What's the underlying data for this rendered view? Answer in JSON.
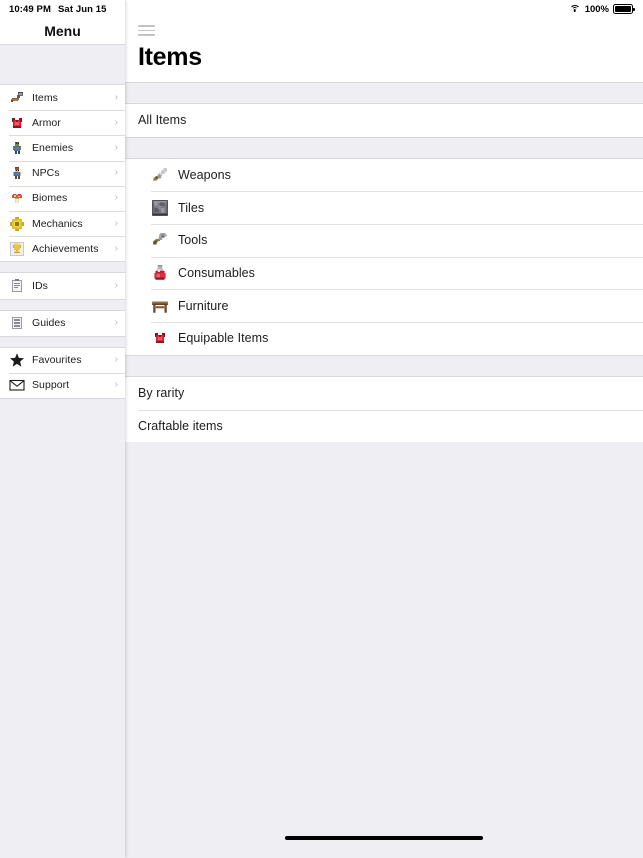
{
  "status_bar": {
    "time": "10:49 PM",
    "date": "Sat Jun 15",
    "battery_percent": "100%",
    "wifi_icon": "wifi-icon",
    "battery_icon": "battery-full-icon"
  },
  "sidebar": {
    "title": "Menu",
    "chevron": "›",
    "groups": [
      {
        "items": [
          {
            "label": "Items",
            "icon": "warhammer-icon"
          },
          {
            "label": "Armor",
            "icon": "breastplate-icon"
          },
          {
            "label": "Enemies",
            "icon": "zombie-icon"
          },
          {
            "label": "NPCs",
            "icon": "npc-guide-icon"
          },
          {
            "label": "Biomes",
            "icon": "mushroom-icon"
          },
          {
            "label": "Mechanics",
            "icon": "cog-icon"
          },
          {
            "label": "Achievements",
            "icon": "trophy-icon"
          }
        ]
      },
      {
        "items": [
          {
            "label": "IDs",
            "icon": "clipboard-icon"
          }
        ]
      },
      {
        "items": [
          {
            "label": "Guides",
            "icon": "book-shelf-icon"
          }
        ]
      },
      {
        "items": [
          {
            "label": "Favourites",
            "icon": "star-icon"
          },
          {
            "label": "Support",
            "icon": "envelope-icon"
          }
        ]
      }
    ]
  },
  "main": {
    "menu_button_icon": "hamburger-menu-icon",
    "title": "Items",
    "sections": [
      {
        "rows": [
          {
            "label": "All Items",
            "icon": null,
            "indent": false
          }
        ]
      },
      {
        "rows": [
          {
            "label": "Weapons",
            "icon": "sword-icon",
            "indent": true
          },
          {
            "label": "Tiles",
            "icon": "stone-block-icon",
            "indent": true
          },
          {
            "label": "Tools",
            "icon": "pickaxe-icon",
            "indent": true
          },
          {
            "label": "Consumables",
            "icon": "potion-icon",
            "indent": true
          },
          {
            "label": "Furniture",
            "icon": "table-icon",
            "indent": true
          },
          {
            "label": "Equipable Items",
            "icon": "breastplate-icon",
            "indent": true
          }
        ]
      },
      {
        "rows": [
          {
            "label": "By rarity",
            "icon": null,
            "indent": false
          },
          {
            "label": "Craftable items",
            "icon": null,
            "indent": false
          }
        ]
      }
    ],
    "home_indicator": "home-indicator"
  },
  "colors": {
    "background": "#eeeef3",
    "surface": "#ffffff",
    "separator": "#e2e2e6",
    "text_primary": "#1c1c1e",
    "chevron": "#b9b9bf"
  }
}
